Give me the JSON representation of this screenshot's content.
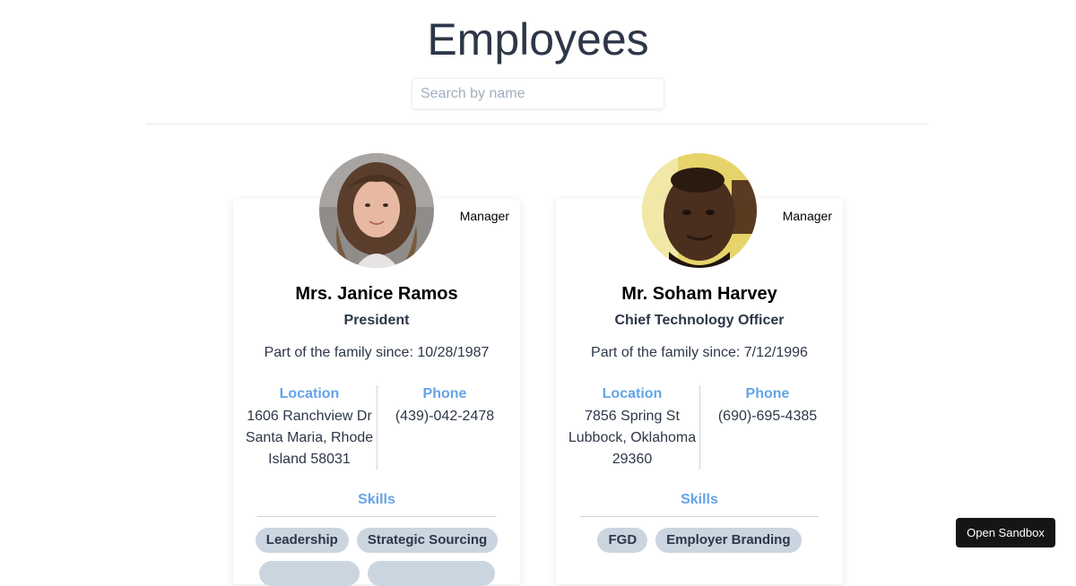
{
  "page": {
    "title": "Employees"
  },
  "search": {
    "placeholder": "Search by name",
    "value": ""
  },
  "employees": [
    {
      "role_badge": "Manager",
      "name": "Mrs. Janice Ramos",
      "job_title": "President",
      "since": "Part of the family since: 10/28/1987",
      "location_label": "Location",
      "location_lines": [
        "1606 Ranchview Dr",
        "Santa Maria, Rhode",
        "Island 58031"
      ],
      "phone_label": "Phone",
      "phone": "(439)-042-2478",
      "skills_label": "Skills",
      "skills": [
        "Leadership",
        "Strategic Sourcing",
        "",
        ""
      ]
    },
    {
      "role_badge": "Manager",
      "name": "Mr. Soham Harvey",
      "job_title": "Chief Technology Officer",
      "since": "Part of the family since: 7/12/1996",
      "location_label": "Location",
      "location_lines": [
        "7856 Spring St",
        "Lubbock, Oklahoma",
        "29360"
      ],
      "phone_label": "Phone",
      "phone": "(690)-695-4385",
      "skills_label": "Skills",
      "skills": [
        "FGD",
        "Employer Branding"
      ]
    }
  ],
  "sandbox": {
    "label": "Open Sandbox"
  },
  "colors": {
    "accent": "#63a4e6",
    "text": "#2d3748",
    "pill": "#cbd5e0"
  }
}
